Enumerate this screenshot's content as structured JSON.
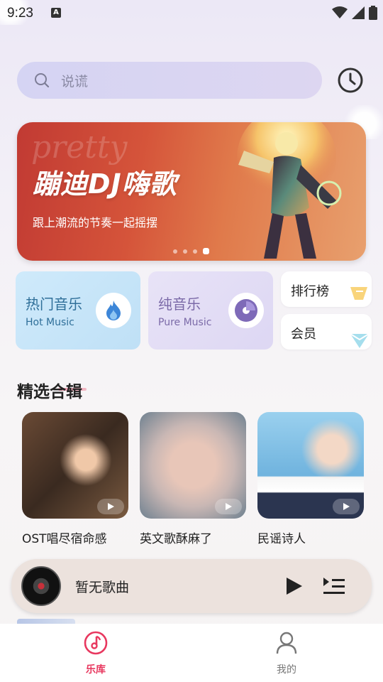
{
  "status_bar": {
    "time": "9:23"
  },
  "search": {
    "placeholder": "说谎"
  },
  "banner": {
    "decor": "pretty",
    "title": "蹦迪DJ嗨歌",
    "subtitle": "跟上潮流的节奏一起摇摆",
    "pages": 4,
    "active_page": 4
  },
  "categories": {
    "hot": {
      "title": "热门音乐",
      "subtitle": "Hot Music"
    },
    "pure": {
      "title": "纯音乐",
      "subtitle": "Pure Music"
    },
    "rank": {
      "title": "排行榜"
    },
    "vip": {
      "title": "会员"
    }
  },
  "featured": {
    "title": "精选合辑",
    "albums": [
      {
        "name": "OST唱尽宿命感"
      },
      {
        "name": "英文歌酥麻了"
      },
      {
        "name": "民谣诗人"
      }
    ]
  },
  "player": {
    "song": "暂无歌曲"
  },
  "tabs": [
    {
      "label": "乐库"
    },
    {
      "label": "我的"
    }
  ],
  "colors": {
    "accent": "#e8385f"
  }
}
